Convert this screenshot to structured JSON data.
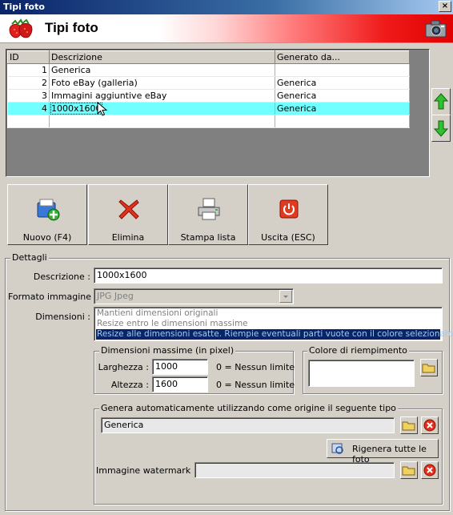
{
  "window": {
    "title": "Tipi foto",
    "close_glyph": "×"
  },
  "header": {
    "title": "Tipi foto",
    "left_icon": "strawberries-icon",
    "right_icon": "camera-icon"
  },
  "grid": {
    "columns": [
      "ID",
      "Descrizione",
      "Generato da..."
    ],
    "rows": [
      {
        "id": "1",
        "desc": "Generica",
        "from": ""
      },
      {
        "id": "2",
        "desc": "Foto eBay (galleria)",
        "from": "Generica"
      },
      {
        "id": "3",
        "desc": "Immagini aggiuntive eBay",
        "from": "Generica"
      },
      {
        "id": "4",
        "desc": "1000x1600",
        "from": "Generica"
      }
    ],
    "selected_row": 3
  },
  "actions": {
    "new_label": "Nuovo (F4)",
    "delete_label": "Elimina",
    "print_label": "Stampa lista",
    "exit_label": "Uscita (ESC)"
  },
  "details": {
    "legend": "Dettagli",
    "descrizione_label": "Descrizione :",
    "descrizione_value": "1000x1600",
    "formato_label": "Formato immagine :",
    "formato_value": "JPG Jpeg",
    "dimensioni_label": "Dimensioni :",
    "dimensioni_options": [
      "Mantieni dimensioni originali",
      "Resize entro le dimensioni massime",
      "Resize alle dimensioni esatte. Riempie eventuali parti vuote con il colore selezionato."
    ],
    "dimensioni_selected": 2,
    "max_dim": {
      "legend": "Dimensioni massime (in pixel)",
      "larghezza_label": "Larghezza :",
      "larghezza_value": "1000",
      "altezza_label": "Altezza :",
      "altezza_value": "1600",
      "no_limit_hint": "0 = Nessun limite"
    },
    "fill_color": {
      "legend": "Colore di riempimento"
    },
    "auto_gen": {
      "legend": "Genera automaticamente utilizzando come origine il seguente tipo",
      "source_value": "Generica",
      "regen_label": "Rigenera tutte le foto",
      "watermark_label": "Immagine watermark :",
      "watermark_value": ""
    }
  },
  "colors": {
    "selection": "#72ffff",
    "header_red": "#e00000",
    "list_selected": "#0a246a"
  }
}
